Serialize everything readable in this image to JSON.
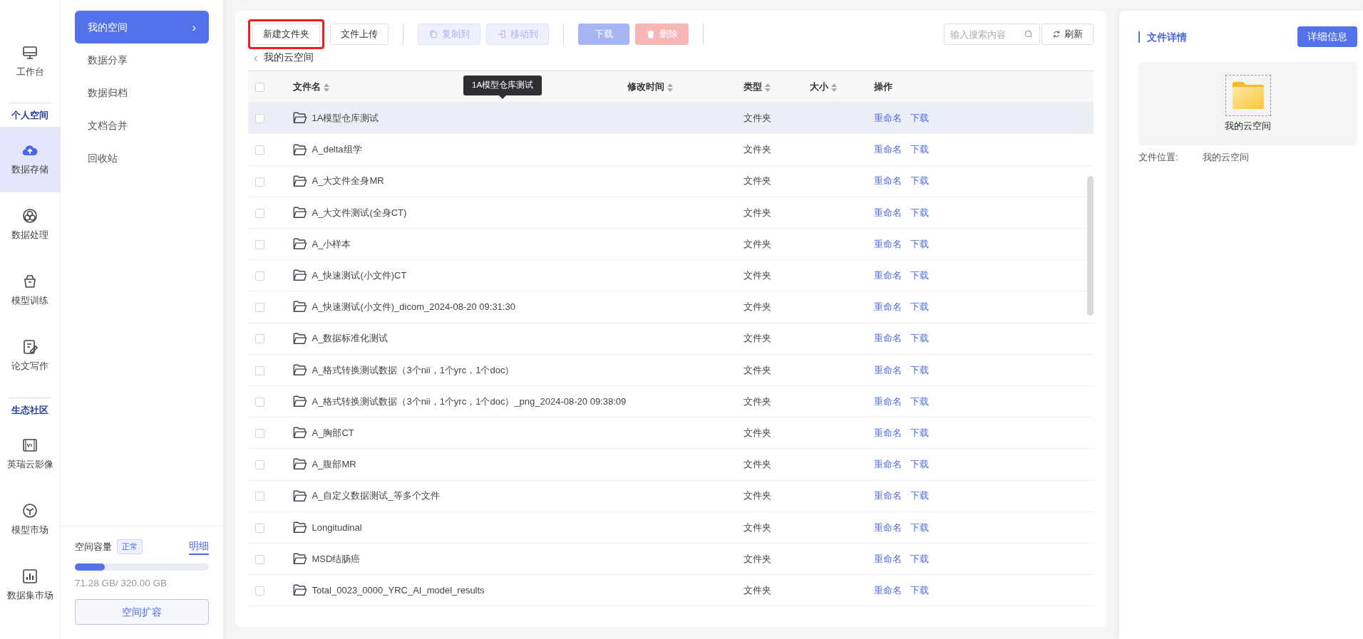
{
  "rail": [
    {
      "kind": "item",
      "label": "工作台",
      "selected": false
    },
    {
      "kind": "section",
      "label": "个人空间"
    },
    {
      "kind": "item",
      "label": "数据存储",
      "selected": true
    },
    {
      "kind": "item",
      "label": "数据处理",
      "selected": false
    },
    {
      "kind": "item",
      "label": "模型训练",
      "selected": false
    },
    {
      "kind": "item",
      "label": "论文写作",
      "selected": false
    },
    {
      "kind": "section",
      "label": "生态社区"
    },
    {
      "kind": "item",
      "label": "英瑞云影像",
      "selected": false
    },
    {
      "kind": "item",
      "label": "模型市场",
      "selected": false
    },
    {
      "kind": "item",
      "label": "数据集市场",
      "selected": false
    }
  ],
  "subnav": {
    "items": [
      {
        "label": "我的空间",
        "selected": true,
        "arrow": "›"
      },
      {
        "label": "数据分享",
        "selected": false
      },
      {
        "label": "数据归档",
        "selected": false
      },
      {
        "label": "文档合并",
        "selected": false
      },
      {
        "label": "回收站",
        "selected": false
      }
    ],
    "storage": {
      "label": "空间容量",
      "status": "正常",
      "detail_link": "明细",
      "level": 0.223,
      "reading": "71.28 GB/ 320.00 GB",
      "expand_button": "空间扩容"
    }
  },
  "toolbar": {
    "buttons": [
      {
        "kind": "outline",
        "label": "新建文件夹",
        "highlighted": true,
        "disabled": false
      },
      {
        "kind": "outline",
        "label": "文件上传",
        "disabled": false
      },
      {
        "kind": "divider"
      },
      {
        "kind": "light",
        "label": "复制到",
        "disabled": true
      },
      {
        "kind": "light",
        "label": "移动到",
        "disabled": true
      },
      {
        "kind": "divider"
      },
      {
        "kind": "primary",
        "label": "下载",
        "disabled": true
      },
      {
        "kind": "danger",
        "label": "删除",
        "disabled": true
      },
      {
        "kind": "divider"
      }
    ],
    "search": {
      "placeholder": "输入搜索内容"
    },
    "refresh": "刷新"
  },
  "breadcrumb": {
    "back": "‹",
    "label": "我的云空间"
  },
  "tooltip": "1A模型仓库测试",
  "table": {
    "select_all": {
      "checked": false
    },
    "columns": [
      {
        "label": "文件名",
        "sortable": true
      },
      {
        "label": "修改时间",
        "sortable": true
      },
      {
        "label": "类型",
        "sortable": true
      },
      {
        "label": "大小",
        "sortable": true
      },
      {
        "label": "操作",
        "sortable": false
      }
    ],
    "rows": [
      {
        "name": "1A模型仓库测试",
        "type": "文件夹",
        "hovered": true,
        "checked": false,
        "actions": [
          "重命名",
          "下载"
        ]
      },
      {
        "name": "A_delta组学",
        "type": "文件夹",
        "hovered": false,
        "checked": false,
        "actions": [
          "重命名",
          "下载"
        ]
      },
      {
        "name": "A_大文件全身MR",
        "type": "文件夹",
        "hovered": false,
        "checked": false,
        "actions": [
          "重命名",
          "下载"
        ]
      },
      {
        "name": "A_大文件测试(全身CT)",
        "type": "文件夹",
        "hovered": false,
        "checked": false,
        "actions": [
          "重命名",
          "下载"
        ]
      },
      {
        "name": "A_小样本",
        "type": "文件夹",
        "hovered": false,
        "checked": false,
        "actions": [
          "重命名",
          "下载"
        ]
      },
      {
        "name": "A_快速测试(小文件)CT",
        "type": "文件夹",
        "hovered": false,
        "checked": false,
        "actions": [
          "重命名",
          "下载"
        ]
      },
      {
        "name": "A_快速测试(小文件)_dicom_2024-08-20 09:31:30",
        "type": "文件夹",
        "hovered": false,
        "checked": false,
        "actions": [
          "重命名",
          "下载"
        ]
      },
      {
        "name": "A_数据标准化测试",
        "type": "文件夹",
        "hovered": false,
        "checked": false,
        "actions": [
          "重命名",
          "下载"
        ]
      },
      {
        "name": "A_格式转换测试数据（3个nii，1个yrc，1个doc）",
        "type": "文件夹",
        "hovered": false,
        "checked": false,
        "actions": [
          "重命名",
          "下载"
        ]
      },
      {
        "name": "A_格式转换测试数据（3个nii，1个yrc，1个doc）_png_2024-08-20 09:38:09",
        "type": "文件夹",
        "hovered": false,
        "checked": false,
        "actions": [
          "重命名",
          "下载"
        ]
      },
      {
        "name": "A_胸部CT",
        "type": "文件夹",
        "hovered": false,
        "checked": false,
        "actions": [
          "重命名",
          "下载"
        ]
      },
      {
        "name": "A_腹部MR",
        "type": "文件夹",
        "hovered": false,
        "checked": false,
        "actions": [
          "重命名",
          "下载"
        ]
      },
      {
        "name": "A_自定义数据测试_等多个文件",
        "type": "文件夹",
        "hovered": false,
        "checked": false,
        "actions": [
          "重命名",
          "下载"
        ]
      },
      {
        "name": "Longitudinal",
        "type": "文件夹",
        "hovered": false,
        "checked": false,
        "actions": [
          "重命名",
          "下载"
        ]
      },
      {
        "name": "MSD结肠癌",
        "type": "文件夹",
        "hovered": false,
        "checked": false,
        "actions": [
          "重命名",
          "下载"
        ]
      },
      {
        "name": "Total_0023_0000_YRC_AI_model_results",
        "type": "文件夹",
        "hovered": false,
        "checked": false,
        "actions": [
          "重命名",
          "下载"
        ]
      }
    ]
  },
  "details": {
    "title": "文件详情",
    "button": "详细信息",
    "preview_name": "我的云空间",
    "location_label": "文件位置:",
    "location_value": "我的云空间"
  }
}
